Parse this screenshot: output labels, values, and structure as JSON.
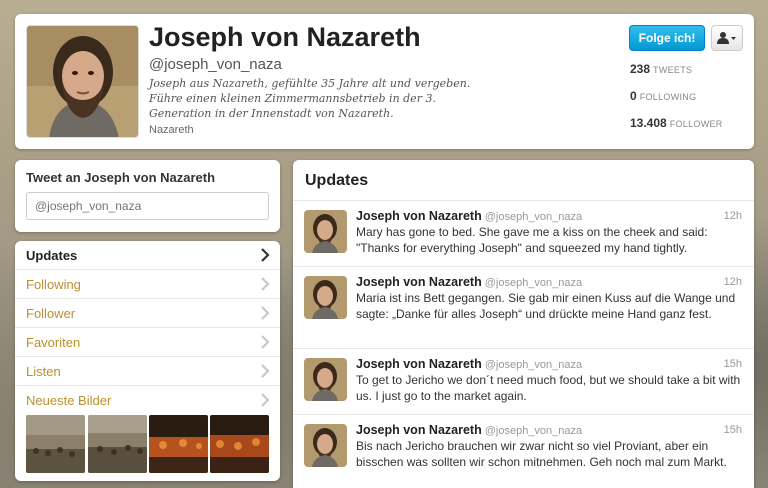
{
  "profile": {
    "name": "Joseph von Nazareth",
    "handle": "@joseph_von_naza",
    "bio": "Joseph aus Nazareth, gefühlte 35 Jahre alt und vergeben. Führe einen kleinen Zimmermannsbetrieb in der 3. Generation in der Innenstadt von Nazareth.",
    "location": "Nazareth",
    "follow_label": "Folge ich!",
    "stats": [
      {
        "number": "238",
        "label": "TWEETS"
      },
      {
        "number": "0",
        "label": "FOLLOWING"
      },
      {
        "number": "13.408",
        "label": "FOLLOWER"
      }
    ]
  },
  "tweet_to": {
    "title": "Tweet an Joseph von Nazareth",
    "placeholder": "@joseph_von_naza"
  },
  "nav": {
    "items": [
      {
        "label": "Updates",
        "active": true
      },
      {
        "label": "Following"
      },
      {
        "label": "Follower"
      },
      {
        "label": "Favoriten"
      },
      {
        "label": "Listen"
      },
      {
        "label": "Neueste Bilder"
      }
    ]
  },
  "timeline": {
    "title": "Updates",
    "tweets": [
      {
        "name": "Joseph von Nazareth",
        "handle": "@joseph_von_naza",
        "time": "12h",
        "text": "Mary has gone to bed. She gave me a kiss on the cheek and said: \"Thanks for everything Joseph\" and squeezed my hand tightly."
      },
      {
        "name": "Joseph von Nazareth",
        "handle": "@joseph_von_naza",
        "time": "12h",
        "text": "Maria ist ins Bett gegangen. Sie gab mir einen Kuss auf die Wange und sagte: „Danke für alles Joseph“ und drückte meine Hand ganz fest."
      },
      {
        "name": "Joseph von Nazareth",
        "handle": "@joseph_von_naza",
        "time": "15h",
        "text": "To get to Jericho we don´t need much food, but we should take a bit with us. I just go to the market again."
      },
      {
        "name": "Joseph von Nazareth",
        "handle": "@joseph_von_naza",
        "time": "15h",
        "text": "Bis nach Jericho brauchen wir zwar nicht so viel Proviant, aber ein bisschen was sollten wir schon mitnehmen. Geh noch mal zum Markt."
      }
    ]
  },
  "icons": {
    "user_menu": "user-icon",
    "chevron": "chevron-right-icon"
  }
}
